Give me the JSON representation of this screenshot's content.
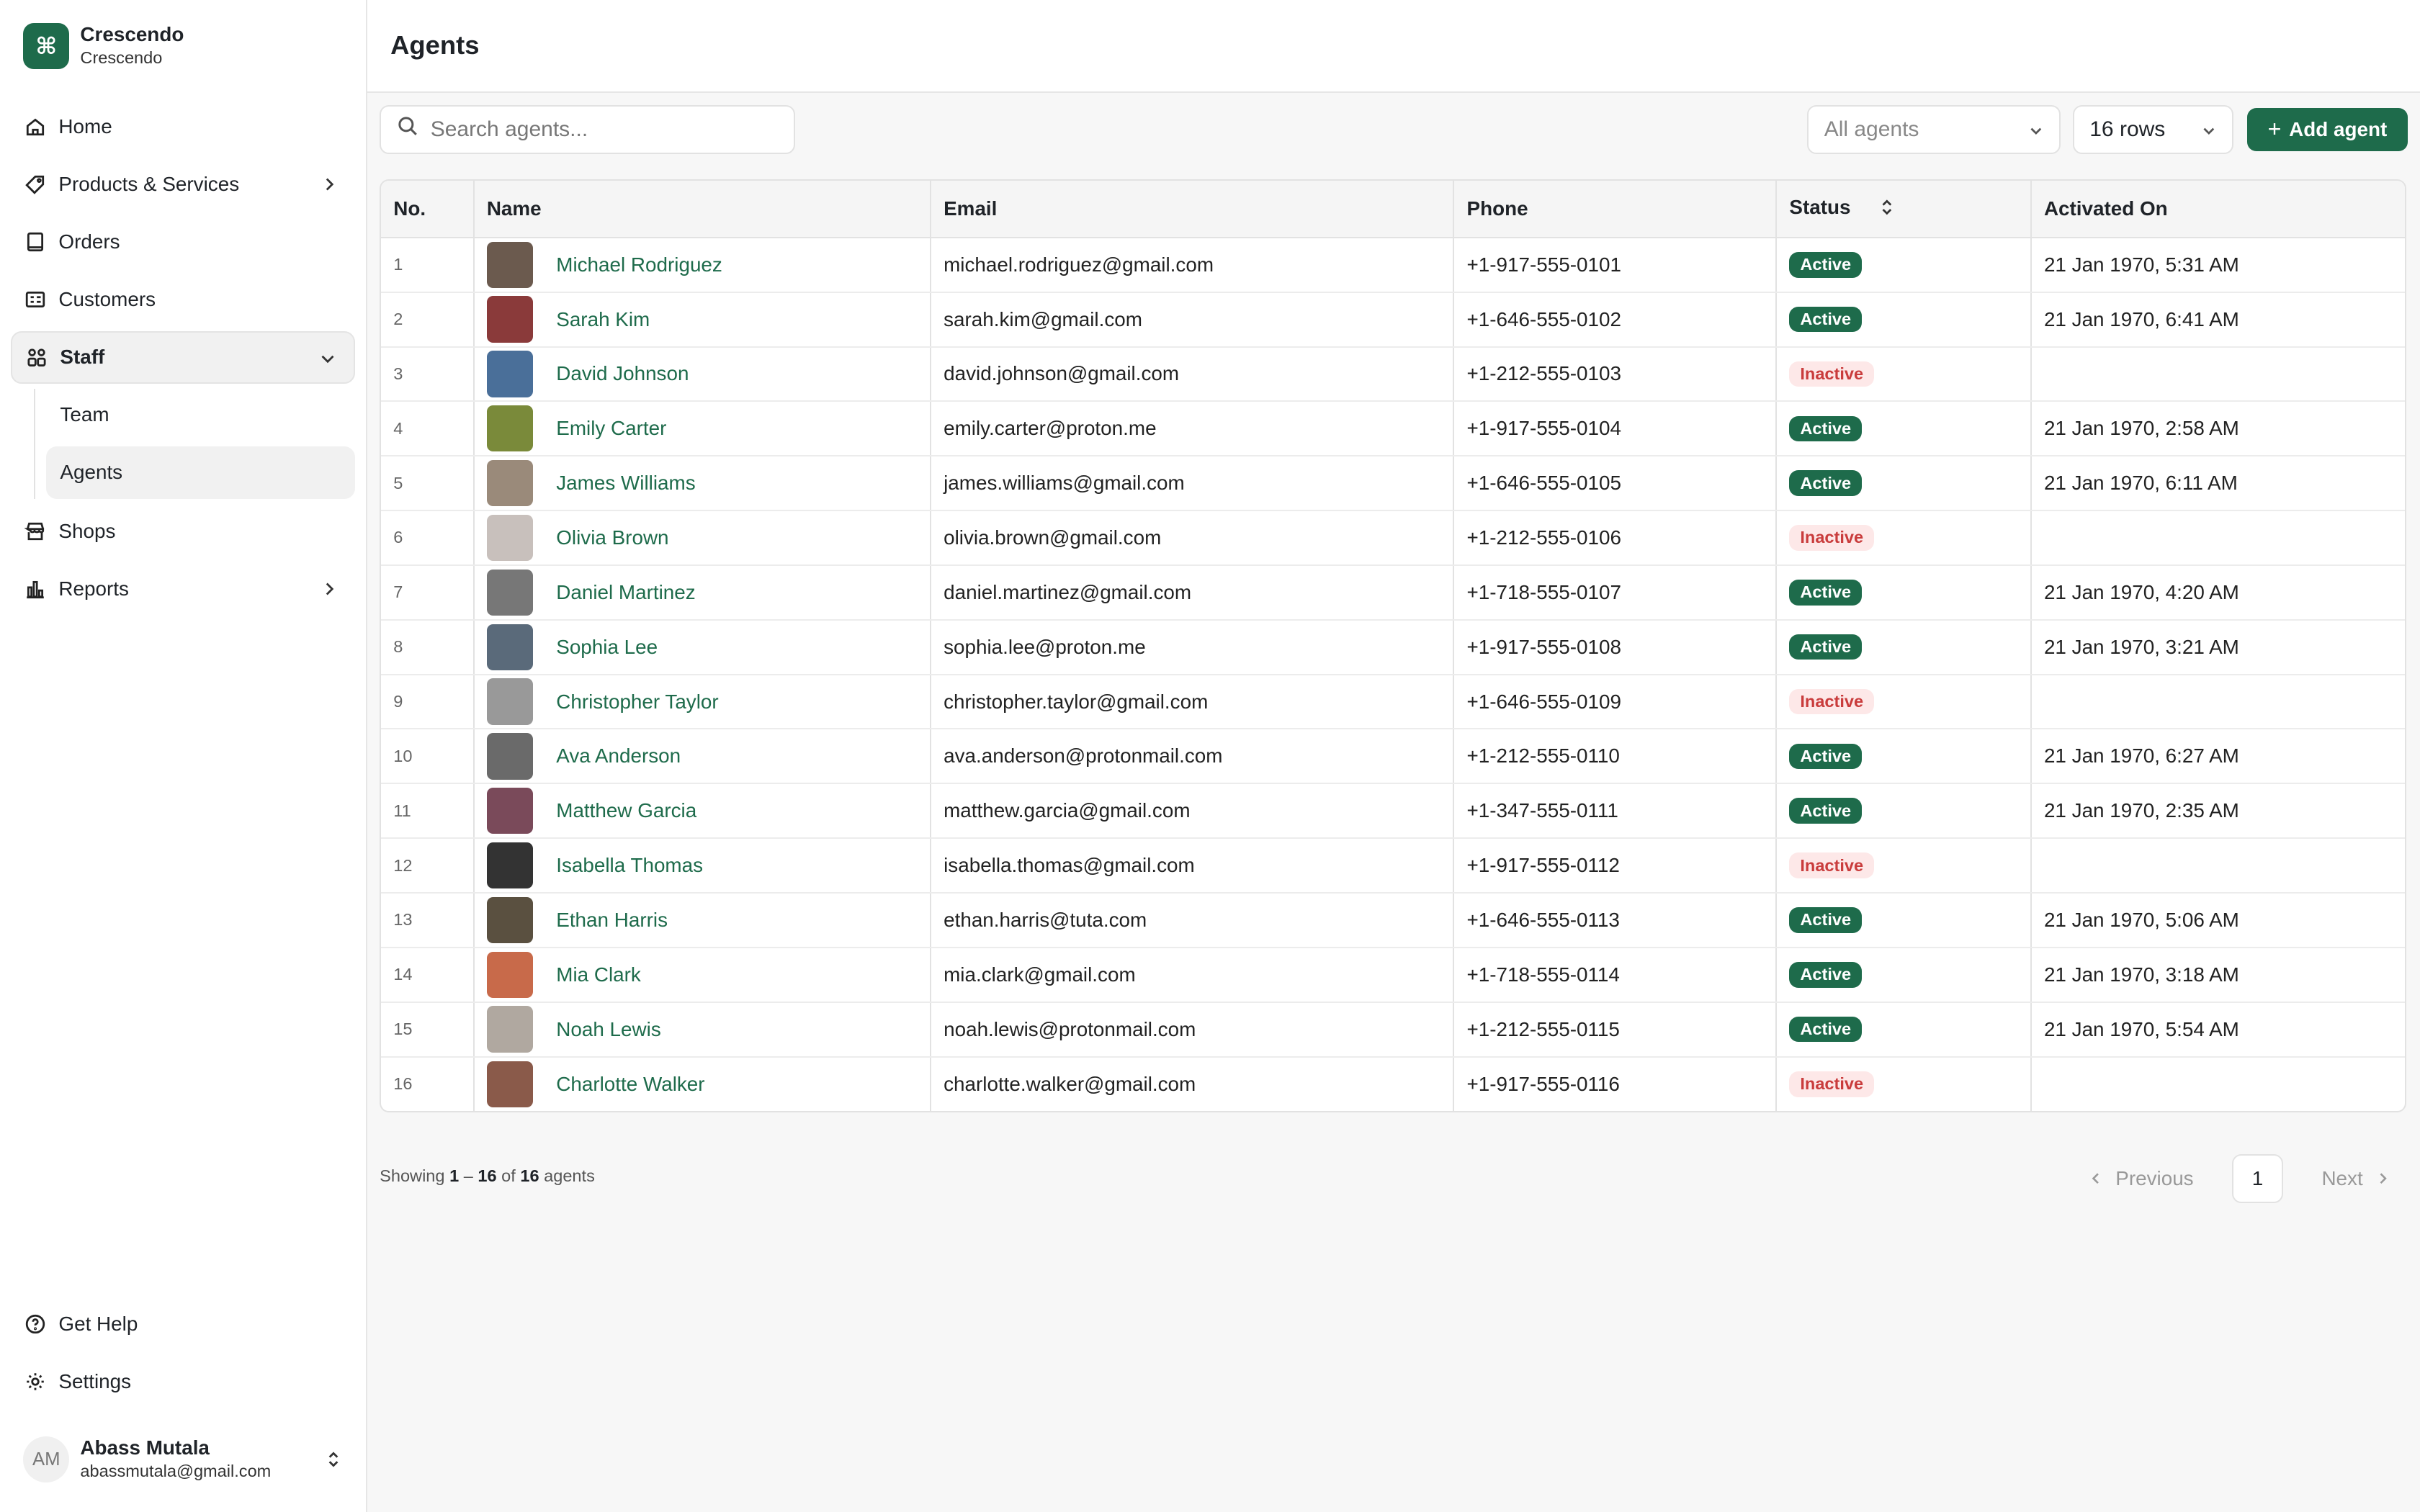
{
  "brand": {
    "name": "Crescendo",
    "subtitle": "Crescendo",
    "logo_icon": "command-icon"
  },
  "nav": {
    "home": "Home",
    "products": "Products & Services",
    "orders": "Orders",
    "customers": "Customers",
    "staff": "Staff",
    "team": "Team",
    "agents": "Agents",
    "shops": "Shops",
    "reports": "Reports",
    "help": "Get Help",
    "settings": "Settings"
  },
  "user": {
    "initials": "AM",
    "name": "Abass Mutala",
    "email": "abassmutala@gmail.com"
  },
  "header": {
    "title": "Agents"
  },
  "toolbar": {
    "search_placeholder": "Search agents...",
    "filter_value": "All agents",
    "rows_value": "16 rows",
    "add_label": "Add agent"
  },
  "table": {
    "columns": [
      "No.",
      "Name",
      "Email",
      "Phone",
      "Status",
      "Activated On"
    ],
    "rows": [
      {
        "no": "1",
        "name": "Michael Rodriguez",
        "email": "michael.rodriguez@gmail.com",
        "phone": "+1-917-555-0101",
        "status": "Active",
        "activated": "21 Jan 1970, 5:31 AM"
      },
      {
        "no": "2",
        "name": "Sarah Kim",
        "email": "sarah.kim@gmail.com",
        "phone": "+1-646-555-0102",
        "status": "Active",
        "activated": "21 Jan 1970, 6:41 AM"
      },
      {
        "no": "3",
        "name": "David Johnson",
        "email": "david.johnson@gmail.com",
        "phone": "+1-212-555-0103",
        "status": "Inactive",
        "activated": ""
      },
      {
        "no": "4",
        "name": "Emily Carter",
        "email": "emily.carter@proton.me",
        "phone": "+1-917-555-0104",
        "status": "Active",
        "activated": "21 Jan 1970, 2:58 AM"
      },
      {
        "no": "5",
        "name": "James Williams",
        "email": "james.williams@gmail.com",
        "phone": "+1-646-555-0105",
        "status": "Active",
        "activated": "21 Jan 1970, 6:11 AM"
      },
      {
        "no": "6",
        "name": "Olivia Brown",
        "email": "olivia.brown@gmail.com",
        "phone": "+1-212-555-0106",
        "status": "Inactive",
        "activated": ""
      },
      {
        "no": "7",
        "name": "Daniel Martinez",
        "email": "daniel.martinez@gmail.com",
        "phone": "+1-718-555-0107",
        "status": "Active",
        "activated": "21 Jan 1970, 4:20 AM"
      },
      {
        "no": "8",
        "name": "Sophia Lee",
        "email": "sophia.lee@proton.me",
        "phone": "+1-917-555-0108",
        "status": "Active",
        "activated": "21 Jan 1970, 3:21 AM"
      },
      {
        "no": "9",
        "name": "Christopher Taylor",
        "email": "christopher.taylor@gmail.com",
        "phone": "+1-646-555-0109",
        "status": "Inactive",
        "activated": ""
      },
      {
        "no": "10",
        "name": "Ava Anderson",
        "email": "ava.anderson@protonmail.com",
        "phone": "+1-212-555-0110",
        "status": "Active",
        "activated": "21 Jan 1970, 6:27 AM"
      },
      {
        "no": "11",
        "name": "Matthew Garcia",
        "email": "matthew.garcia@gmail.com",
        "phone": "+1-347-555-0111",
        "status": "Active",
        "activated": "21 Jan 1970, 2:35 AM"
      },
      {
        "no": "12",
        "name": "Isabella Thomas",
        "email": "isabella.thomas@gmail.com",
        "phone": "+1-917-555-0112",
        "status": "Inactive",
        "activated": ""
      },
      {
        "no": "13",
        "name": "Ethan Harris",
        "email": "ethan.harris@tuta.com",
        "phone": "+1-646-555-0113",
        "status": "Active",
        "activated": "21 Jan 1970, 5:06 AM"
      },
      {
        "no": "14",
        "name": "Mia Clark",
        "email": "mia.clark@gmail.com",
        "phone": "+1-718-555-0114",
        "status": "Active",
        "activated": "21 Jan 1970, 3:18 AM"
      },
      {
        "no": "15",
        "name": "Noah Lewis",
        "email": "noah.lewis@protonmail.com",
        "phone": "+1-212-555-0115",
        "status": "Active",
        "activated": "21 Jan 1970, 5:54 AM"
      },
      {
        "no": "16",
        "name": "Charlotte Walker",
        "email": "charlotte.walker@gmail.com",
        "phone": "+1-917-555-0116",
        "status": "Inactive",
        "activated": ""
      }
    ]
  },
  "footer": {
    "showing_prefix": "Showing",
    "range_start": "1",
    "range_sep": "–",
    "range_end": "16",
    "of": "of",
    "total": "16",
    "suffix": "agents",
    "prev": "Previous",
    "page": "1",
    "next": "Next"
  },
  "colors": {
    "accent": "#1e6b4b",
    "inactive_bg": "#fde8e8",
    "inactive_text": "#c93c3c"
  }
}
